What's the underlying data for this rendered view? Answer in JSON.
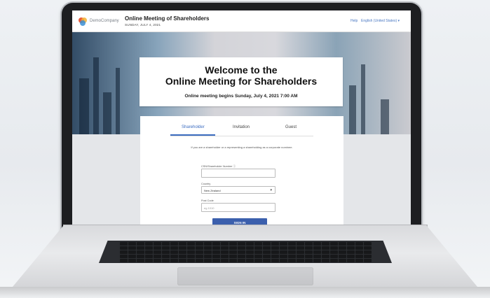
{
  "header": {
    "brand": "DemoCompany",
    "title": "Online Meeting of Shareholders",
    "date": "SUNDAY, JULY 4, 2021",
    "help_label": "Help",
    "language": "English (United States)"
  },
  "welcome": {
    "line1": "Welcome to the",
    "line2": "Online Meeting for Shareholders",
    "subtitle": "Online meeting begins Sunday, July 4, 2021 7:00 AM"
  },
  "tabs": [
    "Shareholder",
    "Invitation",
    "Guest"
  ],
  "active_tab": "Shareholder",
  "form": {
    "intro": "If you are a shareholder or a representing a shareholding as a corporate nominee.",
    "holder_label": "CSN/Shareholder Number",
    "holder_value": "",
    "country_label": "Country",
    "country_value": "New Zealand",
    "postcode_label": "Post Code",
    "postcode_placeholder": "eg 1010",
    "signin_label": "SIGN IN"
  },
  "colors": {
    "accent": "#3b6cc0",
    "button": "#3b5fad",
    "laptop_bezel": "#1d1e21"
  }
}
